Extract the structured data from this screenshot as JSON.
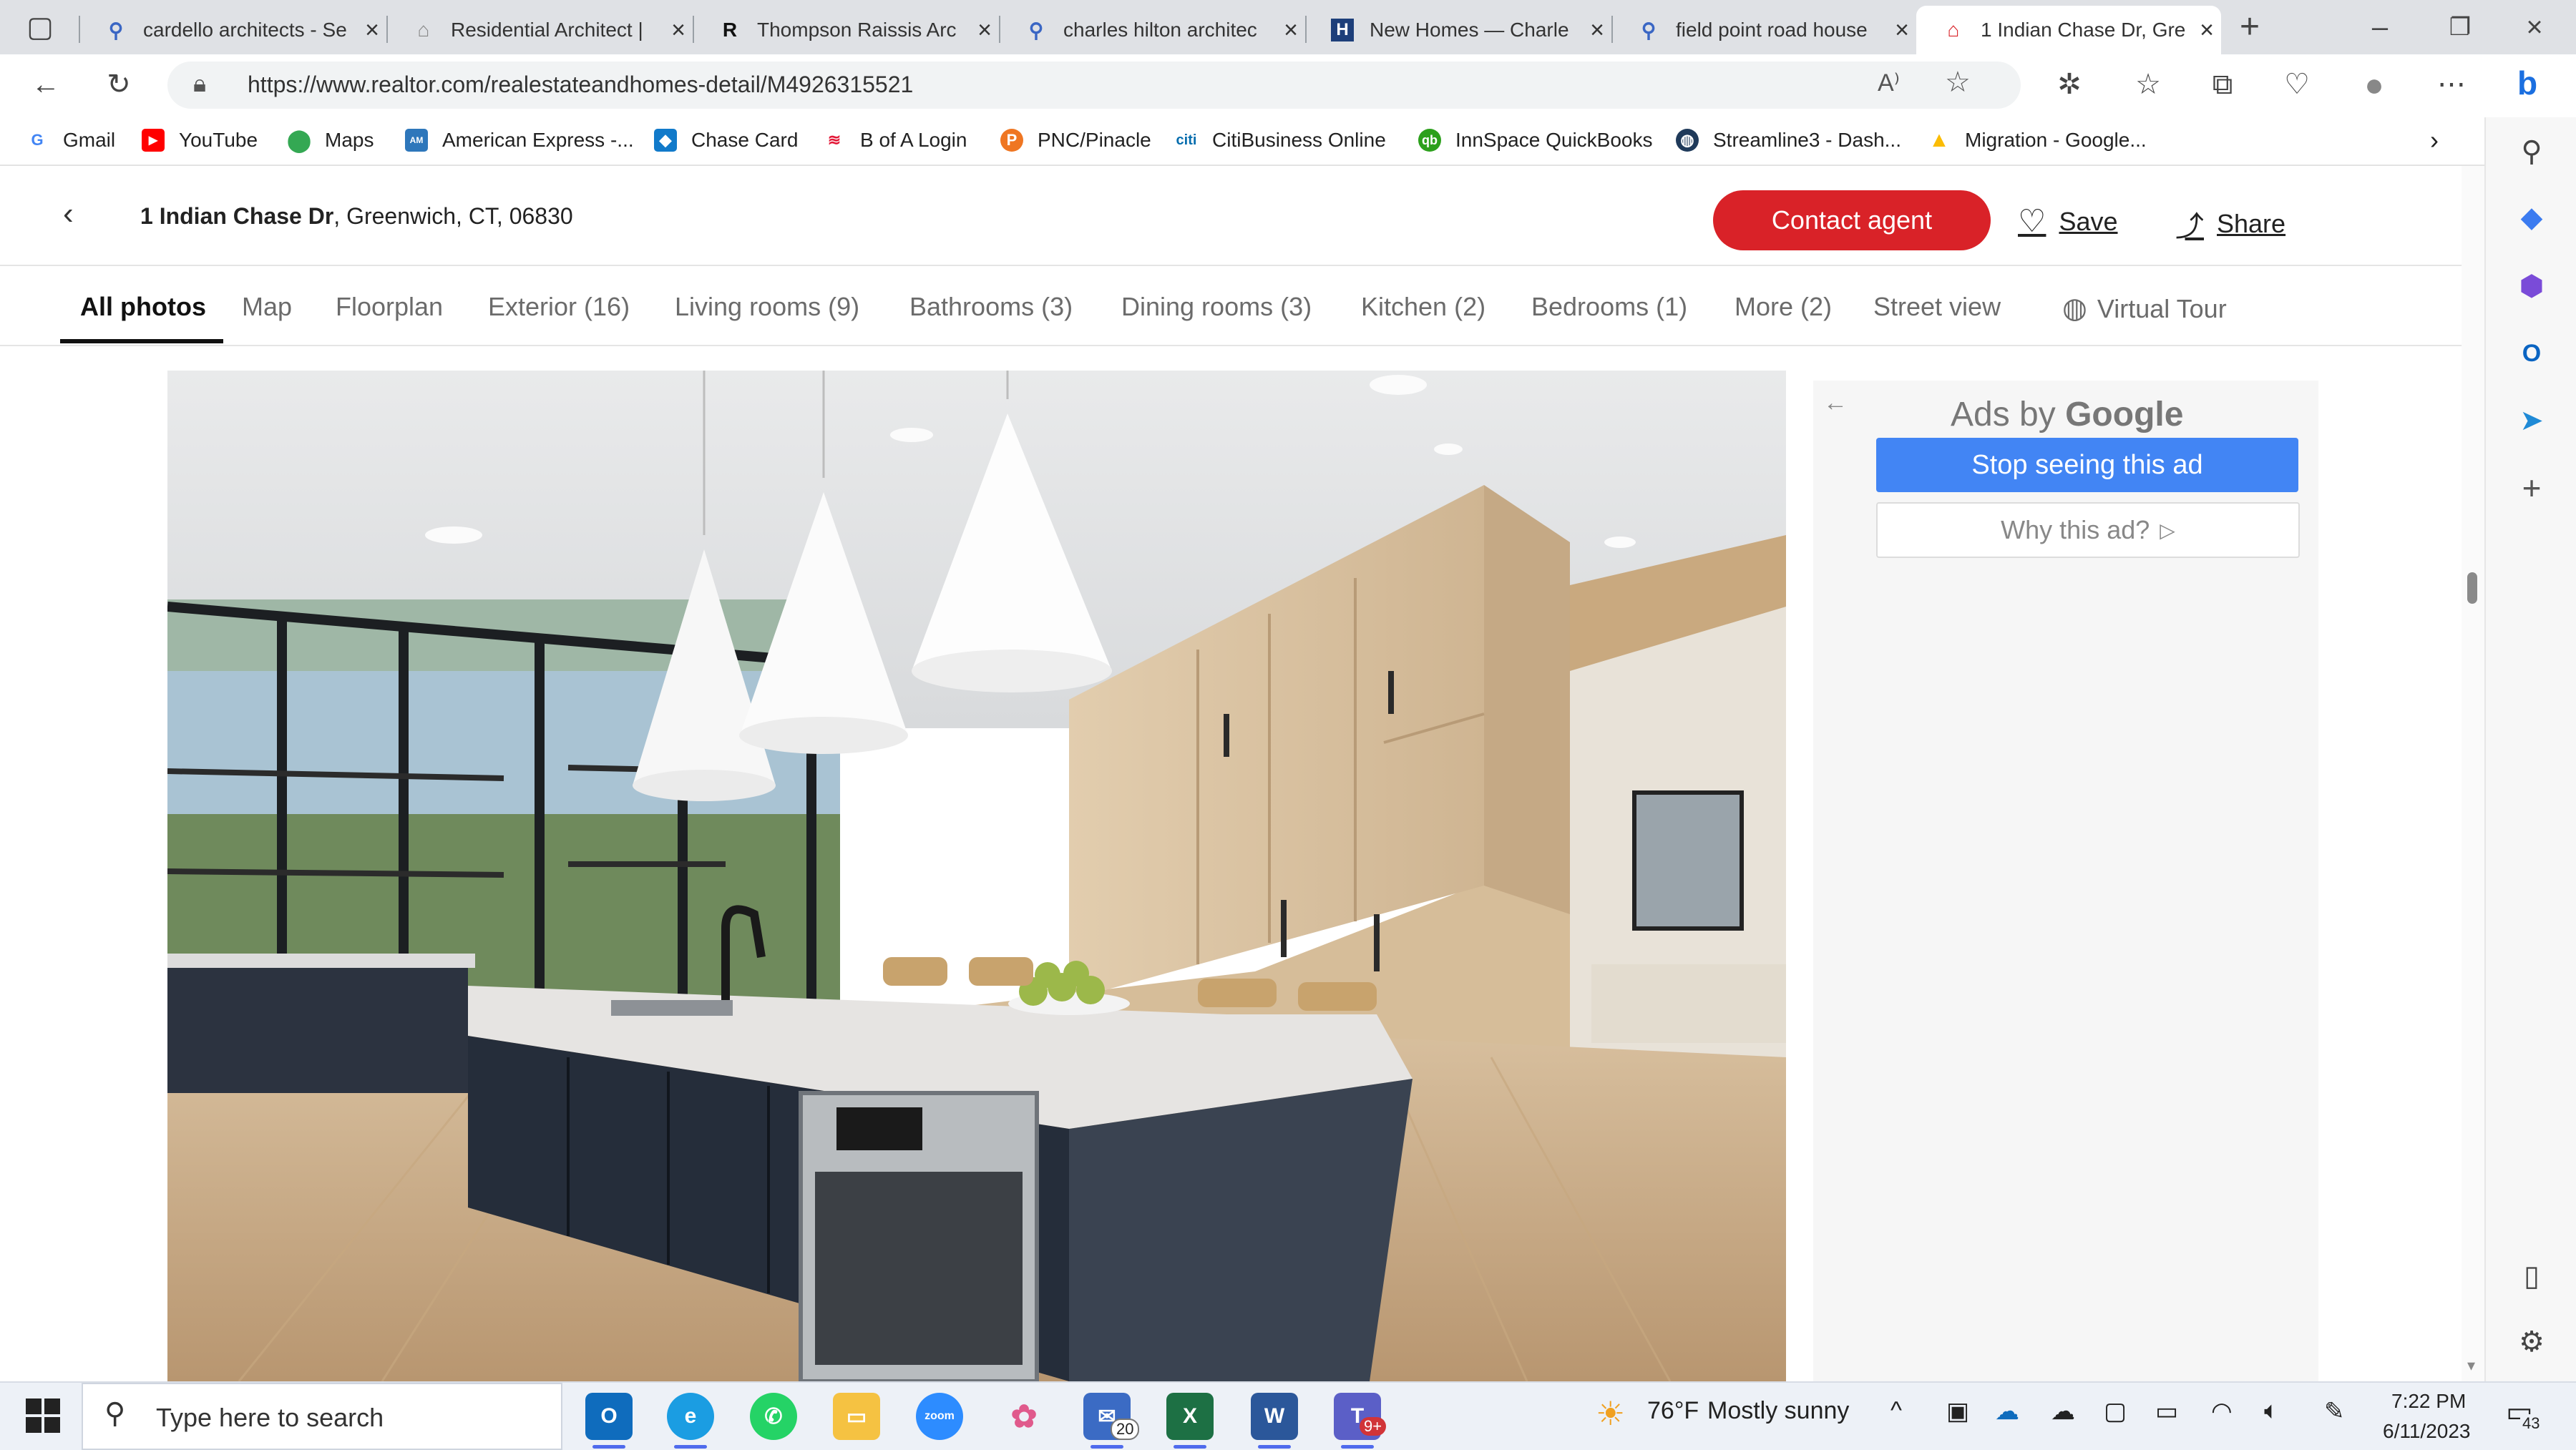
{
  "browser": {
    "tabs": [
      {
        "title": "cardello architects - Se",
        "icon": "search-icon"
      },
      {
        "title": "Residential Architect |",
        "icon": "house-icon"
      },
      {
        "title": "Thompson Raissis Arc",
        "icon": "letter-r-icon"
      },
      {
        "title": "charles hilton architec",
        "icon": "search-icon"
      },
      {
        "title": "New Homes — Charle",
        "icon": "letter-h-icon"
      },
      {
        "title": "field point road house",
        "icon": "search-icon"
      },
      {
        "title": "1 Indian Chase Dr, Gre",
        "icon": "realtor-house-icon",
        "active": true
      }
    ],
    "url": "https://www.realtor.com/realestateandhomes-detail/M4926315521",
    "bookmarks": [
      {
        "label": "Gmail",
        "icon": "google-icon",
        "color": "#4285f4"
      },
      {
        "label": "YouTube",
        "icon": "youtube-icon",
        "color": "#ff0000"
      },
      {
        "label": "Maps",
        "icon": "maps-pin-icon",
        "color": "#34a853"
      },
      {
        "label": "American Express -...",
        "icon": "amex-icon",
        "color": "#2e77bb"
      },
      {
        "label": "Chase Card",
        "icon": "chase-icon",
        "color": "#117aca"
      },
      {
        "label": "B of A Login",
        "icon": "bofa-icon",
        "color": "#e31837"
      },
      {
        "label": "PNC/Pinacle",
        "icon": "pnc-icon",
        "color": "#ef7622"
      },
      {
        "label": "CitiBusiness Online",
        "icon": "citi-icon",
        "color": "#056dae"
      },
      {
        "label": "InnSpace QuickBooks",
        "icon": "quickbooks-icon",
        "color": "#2ca01c"
      },
      {
        "label": "Streamline3 - Dash...",
        "icon": "globe-icon",
        "color": "#1f3a5a"
      },
      {
        "label": "Migration - Google...",
        "icon": "drive-icon",
        "color": "#fbbc04"
      }
    ]
  },
  "listing": {
    "address_bold": "1 Indian Chase Dr",
    "address_rest": ", Greenwich, CT, 06830",
    "contact_label": "Contact agent",
    "save_label": "Save",
    "share_label": "Share",
    "photo_tabs": [
      {
        "label": "All photos",
        "active": true
      },
      {
        "label": "Map"
      },
      {
        "label": "Floorplan"
      },
      {
        "label": "Exterior (16)"
      },
      {
        "label": "Living rooms (9)"
      },
      {
        "label": "Bathrooms (3)"
      },
      {
        "label": "Dining rooms (3)"
      },
      {
        "label": "Kitchen (2)"
      },
      {
        "label": "Bedrooms (1)"
      },
      {
        "label": "More (2)"
      },
      {
        "label": "Street view"
      },
      {
        "label": "Virtual Tour"
      }
    ]
  },
  "ad": {
    "ads_by": "Ads by",
    "google": "Google",
    "stop_label": "Stop seeing this ad",
    "why_label": "Why this ad?"
  },
  "taskbar": {
    "search_placeholder": "Type here to search",
    "mail_badge": "20",
    "teams_badge": "9+",
    "weather_temp": "76°F",
    "weather_text": "Mostly sunny",
    "time": "7:22 PM",
    "date": "6/11/2023",
    "notifications": "43"
  }
}
